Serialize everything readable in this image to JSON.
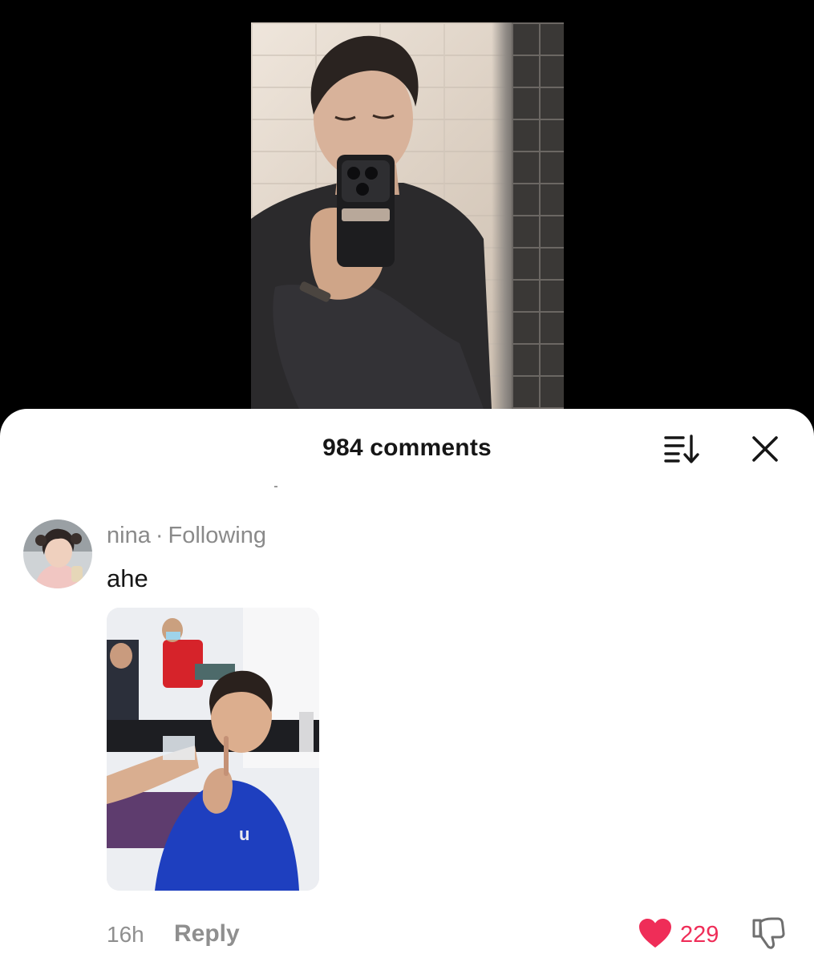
{
  "video": {
    "description_icon": "selfie-video"
  },
  "comments_sheet": {
    "title": "984 comments",
    "sort_icon": "sort-icon",
    "close_icon": "close-icon"
  },
  "comment": {
    "username": "nina",
    "separator": "·",
    "relation": "Following",
    "text": "ahe",
    "time": "16h",
    "reply_label": "Reply",
    "like_count": "229",
    "like_icon": "heart-icon",
    "dislike_icon": "thumbs-down-icon"
  },
  "colors": {
    "accent_like": "#ef2d58",
    "muted_text": "#8a8a8a",
    "primary_text": "#161616"
  }
}
